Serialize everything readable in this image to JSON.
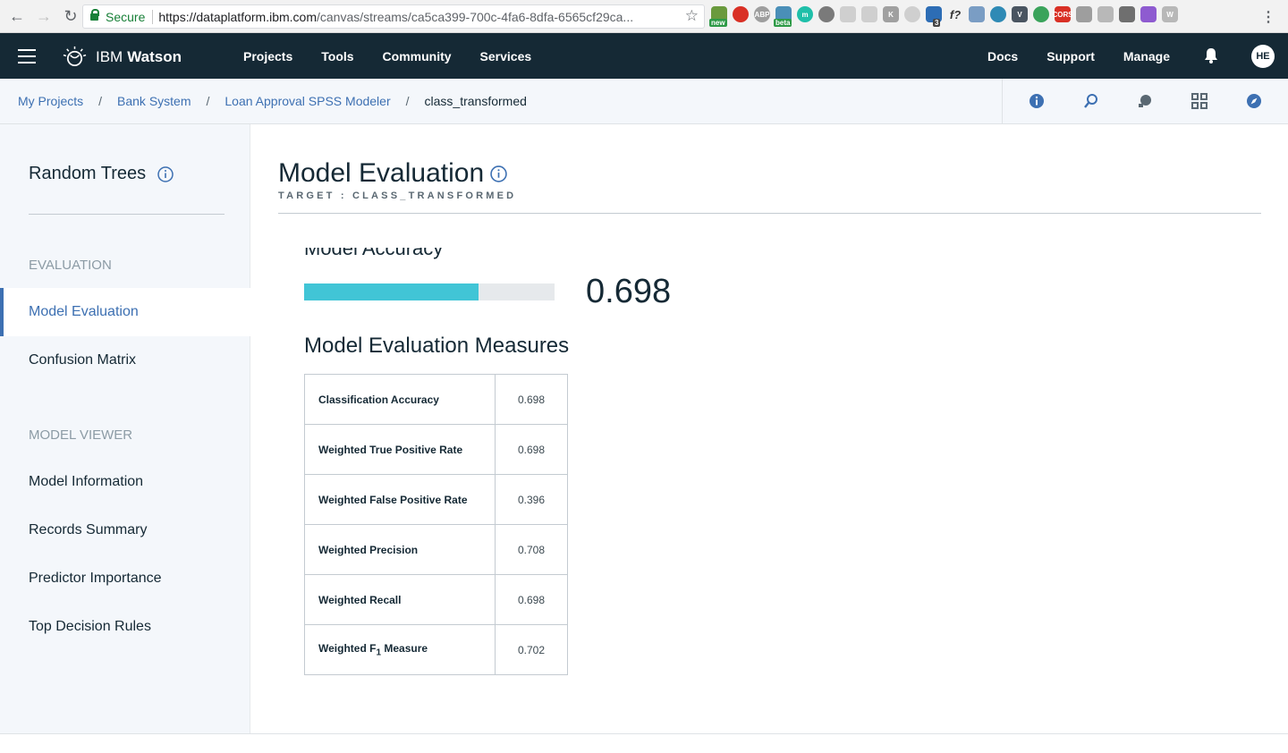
{
  "browser": {
    "secure_label": "Secure",
    "url_host": "https://dataplatform.ibm.com",
    "url_rest": "/canvas/streams/ca5ca399-700c-4fa6-8dfa-6565cf29ca...",
    "extension_badges": {
      "new": "new",
      "beta": "beta",
      "count": "3",
      "fx": "f?"
    }
  },
  "header": {
    "brand_ibm": "IBM",
    "brand_watson": "Watson",
    "nav": [
      "Projects",
      "Tools",
      "Community",
      "Services"
    ],
    "right_nav": [
      "Docs",
      "Support",
      "Manage"
    ],
    "avatar_initials": "HE"
  },
  "breadcrumb": {
    "items": [
      "My Projects",
      "Bank System",
      "Loan Approval SPSS Modeler"
    ],
    "separator": "/",
    "current": "class_transformed"
  },
  "sidebar": {
    "title": "Random Trees",
    "sections": [
      {
        "label": "EVALUATION",
        "items": [
          "Model Evaluation",
          "Confusion Matrix"
        ]
      },
      {
        "label": "MODEL VIEWER",
        "items": [
          "Model Information",
          "Records Summary",
          "Predictor Importance",
          "Top Decision Rules"
        ]
      }
    ],
    "active_item": "Model Evaluation"
  },
  "main": {
    "title": "Model Evaluation",
    "target_label": "TARGET : CLASS_TRANSFORMED",
    "accuracy_heading": "Model Accuracy",
    "accuracy_value": "0.698",
    "accuracy_fraction": 0.698,
    "measures_title": "Model Evaluation Measures",
    "measures": [
      {
        "name": "Classification Accuracy",
        "value": "0.698"
      },
      {
        "name": "Weighted True Positive Rate",
        "value": "0.698"
      },
      {
        "name": "Weighted False Positive Rate",
        "value": "0.396"
      },
      {
        "name": "Weighted Precision",
        "value": "0.708"
      },
      {
        "name": "Weighted Recall",
        "value": "0.698"
      },
      {
        "name": "Weighted F",
        "subscript": "1",
        "name_suffix": " Measure",
        "value": "0.702"
      }
    ]
  },
  "colors": {
    "header_bg": "#152935",
    "accent_blue": "#3d70b2",
    "accuracy_fill": "#41c5d6",
    "sidebar_bg": "#f4f7fb"
  },
  "icons": {
    "toolbar": [
      "info-icon",
      "flow-icon",
      "assist-icon",
      "grid-icon",
      "compass-icon"
    ]
  }
}
